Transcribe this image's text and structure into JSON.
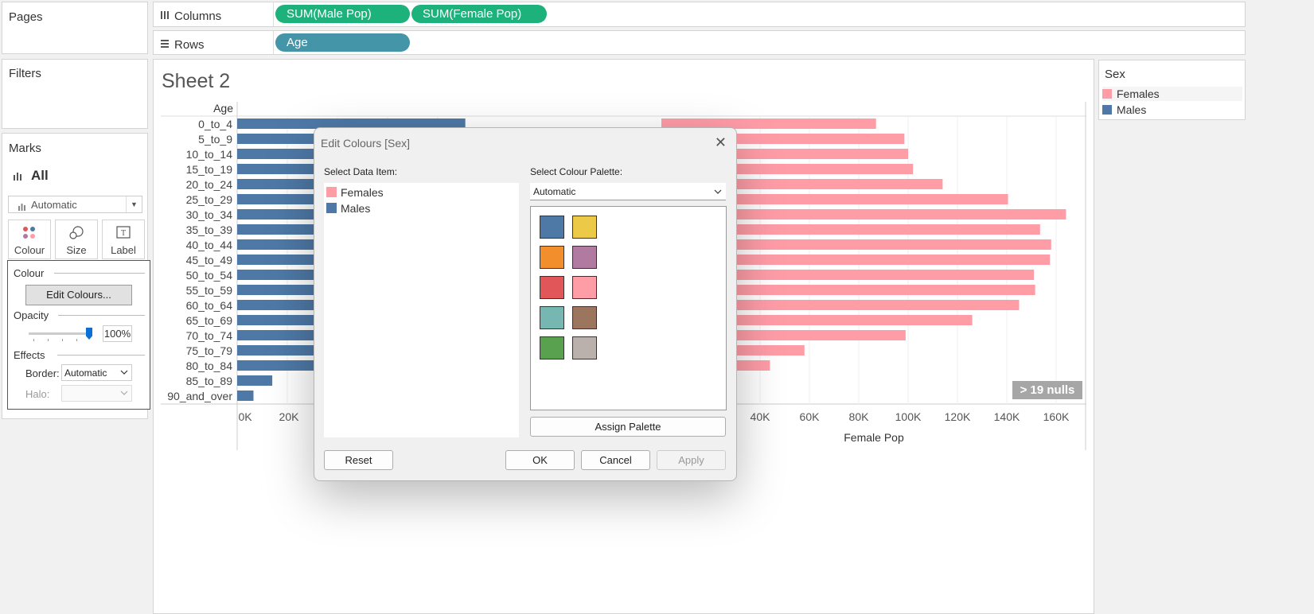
{
  "panels": {
    "pages": "Pages",
    "filters": "Filters",
    "marks": "Marks"
  },
  "shelves": {
    "columns_label": "Columns",
    "columns_pills": [
      "SUM(Male Pop)",
      "SUM(Female Pop)"
    ],
    "rows_label": "Rows",
    "rows_pills": [
      "Age"
    ]
  },
  "marks": {
    "all_label": "All",
    "mark_type": "Automatic",
    "buttons": [
      "Colour",
      "Size",
      "Label"
    ]
  },
  "colour_popover": {
    "colour_title": "Colour",
    "edit_button": "Edit Colours...",
    "opacity_title": "Opacity",
    "opacity_value": "100%",
    "opacity_level": 1.0,
    "effects_title": "Effects",
    "border_label": "Border:",
    "border_value": "Automatic",
    "halo_label": "Halo:"
  },
  "sheet": {
    "title": "Sheet 2",
    "row_header": "Age",
    "nulls_badge": "19 nulls",
    "nulls_prefix": ">"
  },
  "chart_data": {
    "type": "bar",
    "categories": [
      "0_to_4",
      "5_to_9",
      "10_to_14",
      "15_to_19",
      "20_to_24",
      "25_to_29",
      "30_to_34",
      "35_to_39",
      "40_to_44",
      "45_to_49",
      "50_to_54",
      "55_to_59",
      "60_to_64",
      "65_to_69",
      "70_to_74",
      "75_to_79",
      "80_to_84",
      "85_to_89",
      "90_and_over"
    ],
    "series": [
      {
        "name": "Males",
        "color": "#4e79a7",
        "values": [
          91000,
          null,
          null,
          null,
          null,
          null,
          null,
          null,
          null,
          null,
          null,
          null,
          null,
          null,
          null,
          null,
          null,
          14000,
          6500
        ]
      },
      {
        "name": "Females",
        "color": "#ff9da7",
        "values": [
          87000,
          98500,
          100000,
          102000,
          114000,
          140500,
          164000,
          153500,
          158000,
          157500,
          151000,
          151500,
          145000,
          126000,
          99000,
          58000,
          44000,
          null,
          null
        ]
      }
    ],
    "male_ticks": [
      "0K",
      "20K"
    ],
    "female_ticks": [
      "40K",
      "60K",
      "80K",
      "100K",
      "120K",
      "140K",
      "160K"
    ],
    "xlabel": "Female Pop",
    "legend_title": "Sex",
    "legend": [
      "Females",
      "Males"
    ]
  },
  "dialog": {
    "title": "Edit Colours [Sex]",
    "close": "✕",
    "data_item_label": "Select Data Item:",
    "items": [
      {
        "label": "Females",
        "color": "#ff9da7"
      },
      {
        "label": "Males",
        "color": "#4e79a7"
      }
    ],
    "palette_label": "Select Colour Palette:",
    "palette_value": "Automatic",
    "palette_colors": [
      "#4e79a7",
      "#edc948",
      "#f28e2b",
      "#b07aa1",
      "#e15759",
      "#ff9da7",
      "#76b7b2",
      "#9c755f",
      "#59a14f",
      "#bab0ac"
    ],
    "assign": "Assign Palette",
    "reset": "Reset",
    "ok": "OK",
    "cancel": "Cancel",
    "apply": "Apply"
  }
}
